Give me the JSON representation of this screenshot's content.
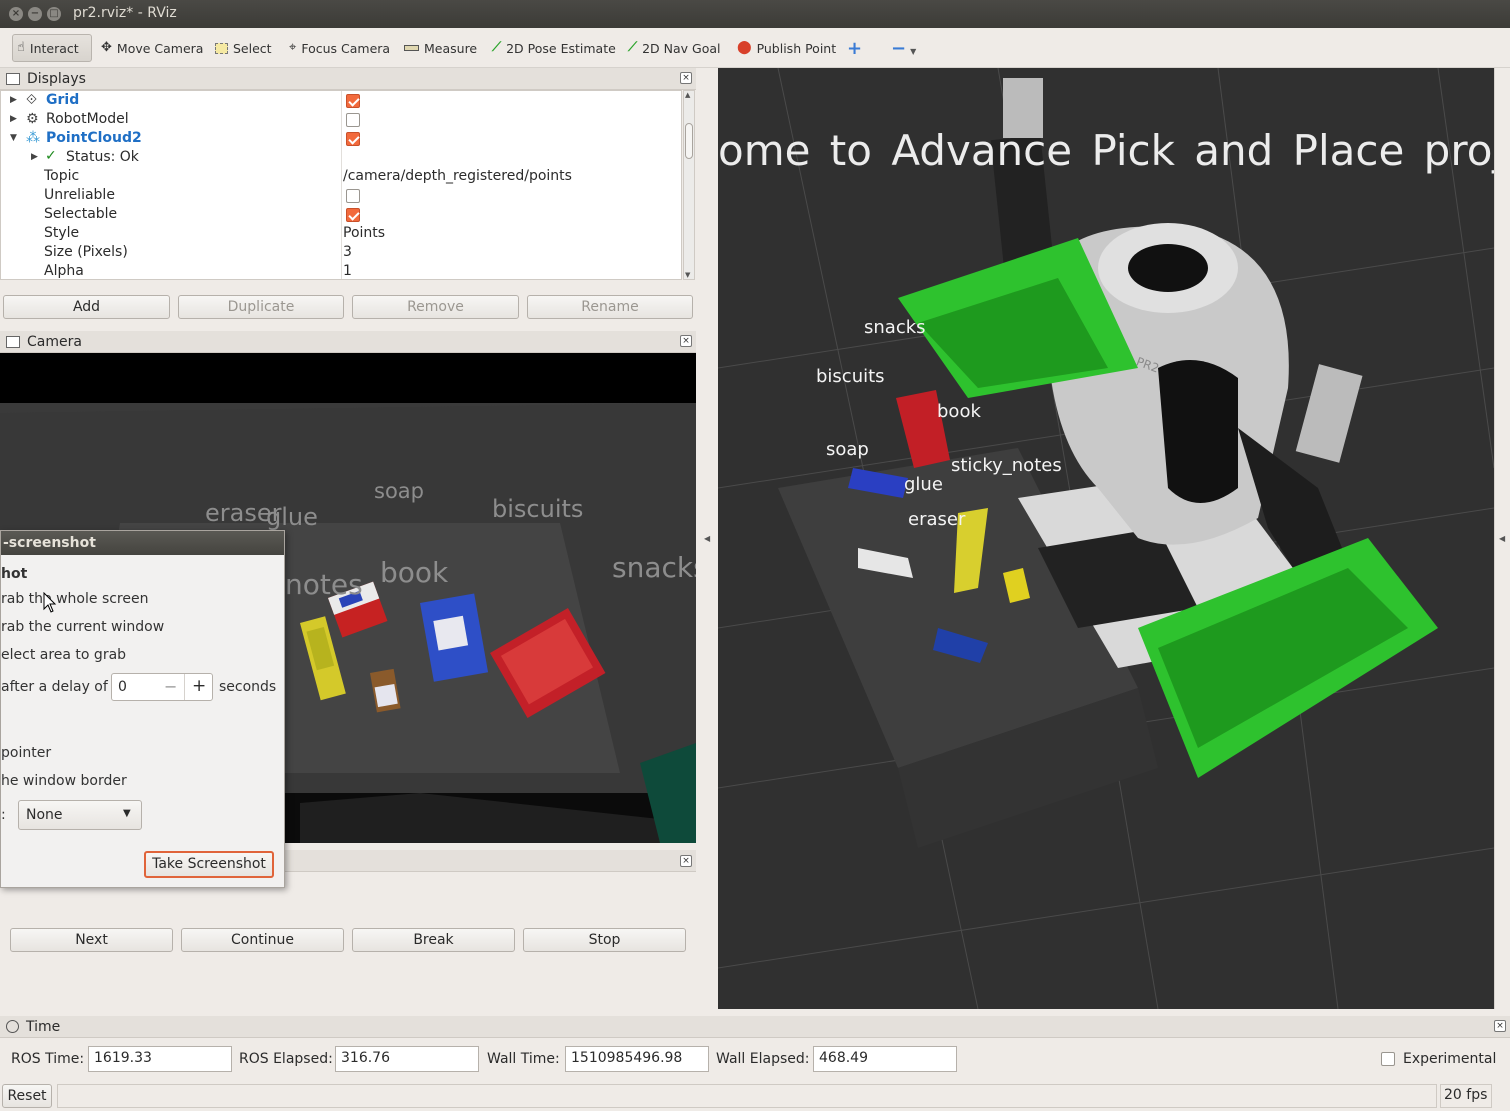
{
  "window": {
    "title": "pr2.rviz* - RViz"
  },
  "toolbar": {
    "tools": [
      {
        "label": "Interact",
        "icon": "hand-icon"
      },
      {
        "label": "Move Camera",
        "icon": "move-camera-icon"
      },
      {
        "label": "Select",
        "icon": "select-icon"
      },
      {
        "label": "Focus Camera",
        "icon": "focus-camera-icon"
      },
      {
        "label": "Measure",
        "icon": "ruler-icon"
      },
      {
        "label": "2D Pose Estimate",
        "icon": "pose-arrow-icon"
      },
      {
        "label": "2D Nav Goal",
        "icon": "nav-arrow-icon"
      },
      {
        "label": "Publish Point",
        "icon": "map-pin-icon"
      }
    ]
  },
  "displays": {
    "title": "Displays",
    "items": [
      {
        "name": "Grid",
        "checked": true
      },
      {
        "name": "RobotModel",
        "checked": false
      },
      {
        "name": "PointCloud2",
        "checked": true
      }
    ],
    "status": "Status: Ok",
    "props": [
      {
        "name": "Topic",
        "value": "/camera/depth_registered/points"
      },
      {
        "name": "Unreliable",
        "checked": false
      },
      {
        "name": "Selectable",
        "checked": true
      },
      {
        "name": "Style",
        "value": "Points"
      },
      {
        "name": "Size (Pixels)",
        "value": "3"
      },
      {
        "name": "Alpha",
        "value": "1"
      }
    ],
    "buttons": {
      "add": "Add",
      "duplicate": "Duplicate",
      "remove": "Remove",
      "rename": "Rename"
    }
  },
  "camera": {
    "title": "Camera",
    "labels": [
      "eraser",
      "glue",
      "soap",
      "biscuits",
      "notes",
      "book",
      "snacks"
    ]
  },
  "screenshot_dialog": {
    "title": "-screenshot",
    "section": "hot",
    "options": [
      "rab the whole screen",
      "rab the current window",
      "elect area to grab"
    ],
    "delay_prefix": "after a delay of",
    "delay_value": "0",
    "delay_minus": "−",
    "delay_plus": "+",
    "delay_suffix": "seconds",
    "pointer": "pointer",
    "border": "he window border",
    "effect_prefix": ":",
    "effect_value": "None",
    "take_button": "Take Screenshot"
  },
  "panel3": {
    "buttons": {
      "next": "Next",
      "continue": "Continue",
      "break": "Break",
      "stop": "Stop"
    }
  },
  "view3d": {
    "banner": "ome  to  Advance  Pick  and  Place  proje",
    "labels": {
      "snacks": "snacks",
      "biscuits": "biscuits",
      "book": "book",
      "soap": "soap",
      "sticky_notes": "sticky_notes",
      "glue": "glue",
      "eraser": "eraser"
    },
    "robot_badge": "PR2"
  },
  "time": {
    "title": "Time",
    "ros_time_label": "ROS Time:",
    "ros_time": "1619.33",
    "ros_elapsed_label": "ROS Elapsed:",
    "ros_elapsed": "316.76",
    "wall_time_label": "Wall Time:",
    "wall_time": "1510985496.98",
    "wall_elapsed_label": "Wall Elapsed:",
    "wall_elapsed": "468.49",
    "experimental_label": "Experimental"
  },
  "statusbar": {
    "reset": "Reset",
    "fps": "20 fps"
  }
}
